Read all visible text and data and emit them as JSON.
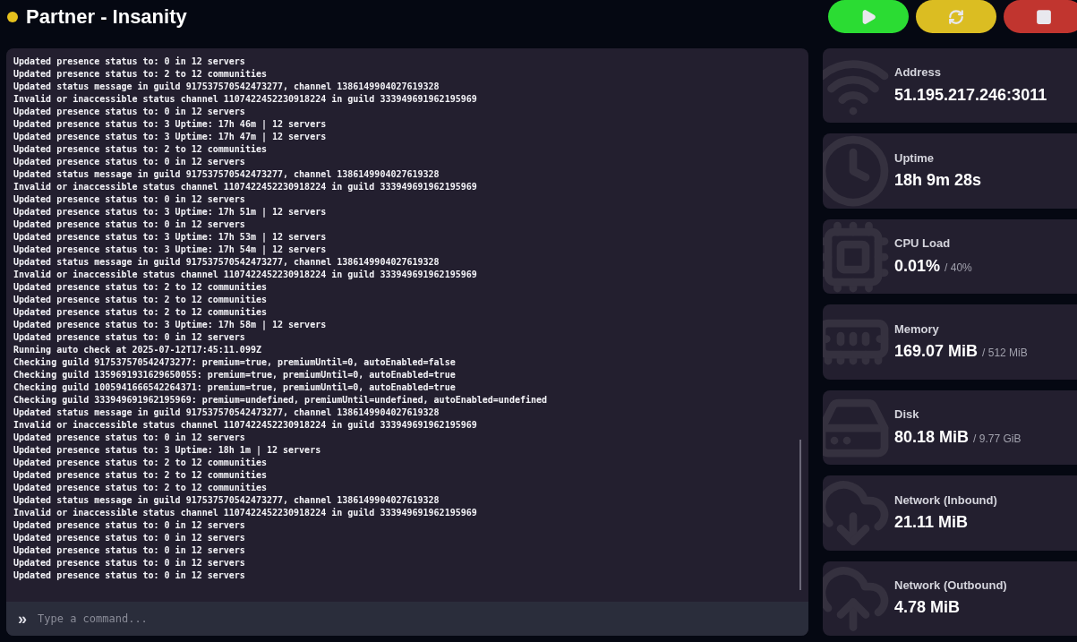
{
  "server": {
    "name": "Partner - Insanity",
    "status_dot": {
      "color": "#e5c01d"
    }
  },
  "power_buttons": [
    {
      "kind": "start"
    },
    {
      "kind": "restart"
    },
    {
      "kind": "stop"
    }
  ],
  "console": {
    "lines": [
      "Updated presence status to: 0 in 12 servers",
      "Updated presence status to: 2 to 12 communities",
      "Updated status message in guild 917537570542473277, channel 1386149904027619328",
      "Invalid or inaccessible status channel 1107422452230918224 in guild 333949691962195969",
      "Updated presence status to: 0 in 12 servers",
      "Updated presence status to: 3 Uptime: 17h 46m | 12 servers",
      "Updated presence status to: 3 Uptime: 17h 47m | 12 servers",
      "Updated presence status to: 2 to 12 communities",
      "Updated presence status to: 0 in 12 servers",
      "Updated status message in guild 917537570542473277, channel 1386149904027619328",
      "Invalid or inaccessible status channel 1107422452230918224 in guild 333949691962195969",
      "Updated presence status to: 0 in 12 servers",
      "Updated presence status to: 3 Uptime: 17h 51m | 12 servers",
      "Updated presence status to: 0 in 12 servers",
      "Updated presence status to: 3 Uptime: 17h 53m | 12 servers",
      "Updated presence status to: 3 Uptime: 17h 54m | 12 servers",
      "Updated status message in guild 917537570542473277, channel 1386149904027619328",
      "Invalid or inaccessible status channel 1107422452230918224 in guild 333949691962195969",
      "Updated presence status to: 2 to 12 communities",
      "Updated presence status to: 2 to 12 communities",
      "Updated presence status to: 2 to 12 communities",
      "Updated presence status to: 3 Uptime: 17h 58m | 12 servers",
      "Updated presence status to: 0 in 12 servers",
      "Running auto check at 2025-07-12T17:45:11.099Z",
      "Checking guild 917537570542473277: premium=true, premiumUntil=0, autoEnabled=false",
      "Checking guild 1359691931629650055: premium=true, premiumUntil=0, autoEnabled=true",
      "Checking guild 1005941666542264371: premium=true, premiumUntil=0, autoEnabled=true",
      "Checking guild 333949691962195969: premium=undefined, premiumUntil=undefined, autoEnabled=undefined",
      "Updated status message in guild 917537570542473277, channel 1386149904027619328",
      "Invalid or inaccessible status channel 1107422452230918224 in guild 333949691962195969",
      "Updated presence status to: 0 in 12 servers",
      "Updated presence status to: 3 Uptime: 18h 1m | 12 servers",
      "Updated presence status to: 2 to 12 communities",
      "Updated presence status to: 2 to 12 communities",
      "Updated presence status to: 2 to 12 communities",
      "Updated status message in guild 917537570542473277, channel 1386149904027619328",
      "Invalid or inaccessible status channel 1107422452230918224 in guild 333949691962195969",
      "Updated presence status to: 0 in 12 servers",
      "Updated presence status to: 0 in 12 servers",
      "Updated presence status to: 0 in 12 servers",
      "Updated presence status to: 0 in 12 servers",
      "Updated presence status to: 0 in 12 servers"
    ],
    "prompt": "»",
    "placeholder": "Type a command..."
  },
  "stats": [
    {
      "kind": "address",
      "label": "Address",
      "value": "51.195.217.246:3011"
    },
    {
      "kind": "uptime",
      "label": "Uptime",
      "value": "18h 9m 28s"
    },
    {
      "kind": "cpu",
      "label": "CPU Load",
      "value": "0.01%",
      "limit": "/ 40%"
    },
    {
      "kind": "memory",
      "label": "Memory",
      "value": "169.07 MiB",
      "limit": "/ 512 MiB"
    },
    {
      "kind": "disk",
      "label": "Disk",
      "value": "80.18 MiB",
      "limit": "/ 9.77 GiB"
    },
    {
      "kind": "inbound",
      "label": "Network (Inbound)",
      "value": "21.11 MiB"
    },
    {
      "kind": "outbound",
      "label": "Network (Outbound)",
      "value": "4.78 MiB"
    }
  ]
}
